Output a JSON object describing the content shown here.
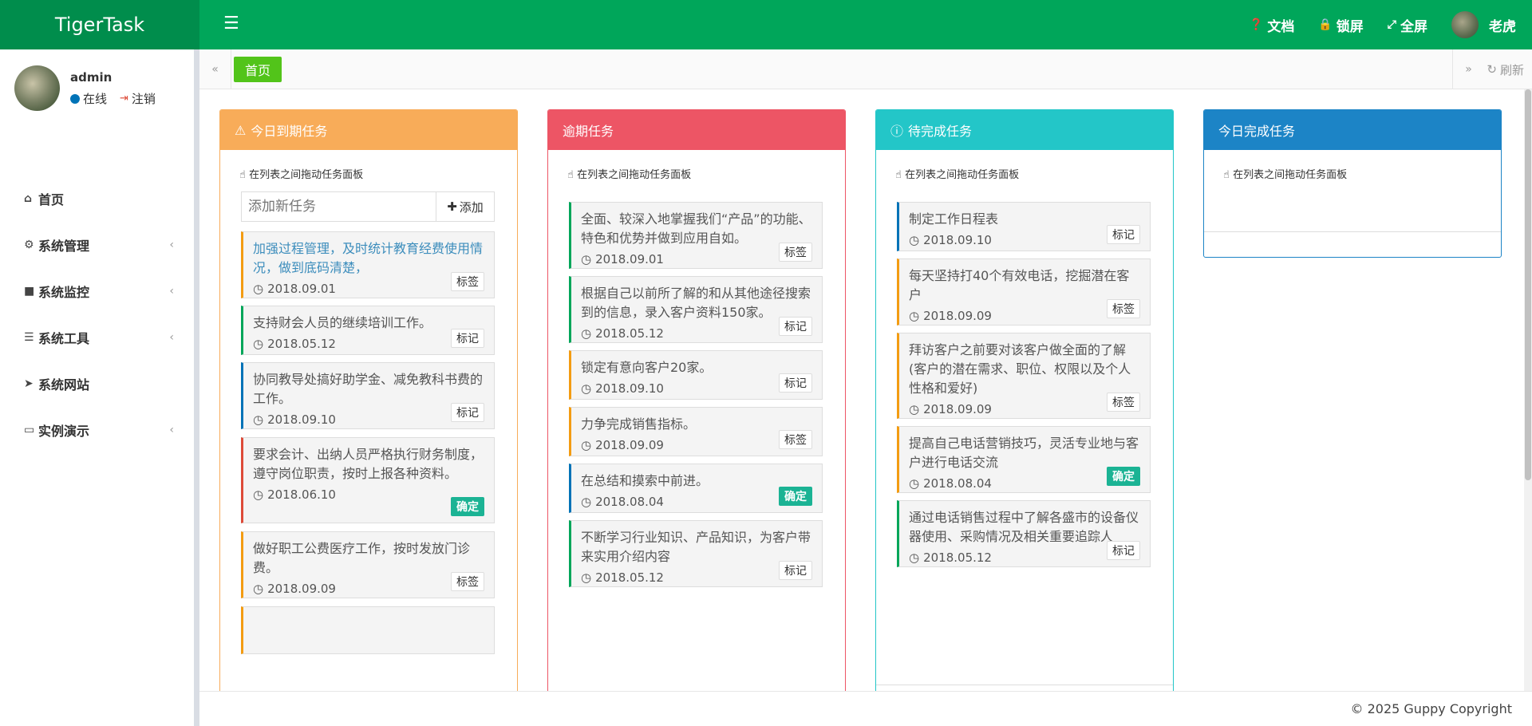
{
  "app": {
    "title": "TigerTask"
  },
  "topnav": {
    "docs": "文档",
    "lock": "锁屏",
    "fullscreen": "全屏",
    "user": "老虎"
  },
  "sidebar": {
    "user_name": "admin",
    "status": "在线",
    "logout": "注销",
    "items": [
      {
        "label": "首页",
        "icon": "home-icon"
      },
      {
        "label": "系统管理",
        "icon": "gear-icon"
      },
      {
        "label": "系统监控",
        "icon": "video-camera-icon"
      },
      {
        "label": "系统工具",
        "icon": "list-icon"
      },
      {
        "label": "系统网站",
        "icon": "location-arrow-icon"
      },
      {
        "label": "实例演示",
        "icon": "desktop-icon"
      }
    ]
  },
  "tabs": {
    "home": "首页",
    "refresh": "刷新"
  },
  "hint": "在列表之间拖动任务面板",
  "columns": [
    {
      "title": "今日到期任务",
      "color": "#f8ac59",
      "icon": "warning-icon",
      "add_placeholder": "添加新任务",
      "add_label": "添加",
      "cards": [
        {
          "text": "加强过程管理，及时统计教育经费使用情况，做到底码清楚，",
          "date": "2018.09.01",
          "badge": "标签"
        },
        {
          "text": "支持财会人员的继续培训工作。",
          "date": "2018.05.12",
          "badge": "标记"
        },
        {
          "text": "协同教导处搞好助学金、减免教科书费的工作。",
          "date": "2018.09.10",
          "badge": "标记"
        },
        {
          "text": "要求会计、出纳人员严格执行财务制度，遵守岗位职责，按时上报各种资料。",
          "date": "2018.06.10",
          "badge": "确定"
        },
        {
          "text": "做好职工公费医疗工作，按时发放门诊费。",
          "date": "2018.09.09",
          "badge": "标签"
        }
      ]
    },
    {
      "title": "逾期任务",
      "color": "#ed5565",
      "cards": [
        {
          "text": "全面、较深入地掌握我们“产品”的功能、特色和优势并做到应用自如。",
          "date": "2018.09.01",
          "badge": "标签"
        },
        {
          "text": "根据自己以前所了解的和从其他途径搜索到的信息，录入客户资料150家。",
          "date": "2018.05.12",
          "badge": "标记"
        },
        {
          "text": "锁定有意向客户20家。",
          "date": "2018.09.10",
          "badge": "标记"
        },
        {
          "text": "力争完成销售指标。",
          "date": "2018.09.09",
          "badge": "标签"
        },
        {
          "text": "在总结和摸索中前进。",
          "date": "2018.08.04",
          "badge": "确定"
        },
        {
          "text": "不断学习行业知识、产品知识，为客户带来实用介绍内容",
          "date": "2018.05.12",
          "badge": "标记"
        }
      ]
    },
    {
      "title": "待完成任务",
      "color": "#23c6c8",
      "icon": "info-icon",
      "cards": [
        {
          "text": "制定工作日程表",
          "date": "2018.09.10",
          "badge": "标记"
        },
        {
          "text": "每天坚持打40个有效电话，挖掘潜在客户",
          "date": "2018.09.09",
          "badge": "标签"
        },
        {
          "text": "拜访客户之前要对该客户做全面的了解(客户的潜在需求、职位、权限以及个人性格和爱好)",
          "date": "2018.09.09",
          "badge": "标签"
        },
        {
          "text": "提高自己电话营销技巧，灵活专业地与客户进行电话交流",
          "date": "2018.08.04",
          "badge": "确定"
        },
        {
          "text": "通过电话销售过程中了解各盛市的设备仪器使用、采购情况及相关重要追踪人",
          "date": "2018.05.12",
          "badge": "标记"
        }
      ]
    },
    {
      "title": "今日完成任务",
      "color": "#1c84c6",
      "cards": []
    }
  ],
  "footer": "© 2025 Guppy Copyright"
}
